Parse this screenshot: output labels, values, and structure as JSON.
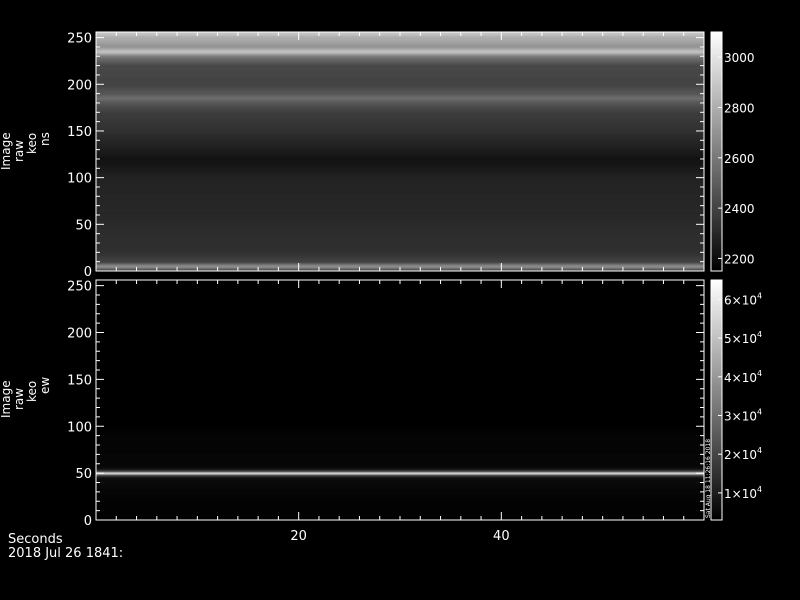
{
  "footer": {
    "xlabel": "Seconds",
    "date": "2018 Jul 26 1841:"
  },
  "colors": {
    "background": "#000000",
    "axis": "#ffffff"
  },
  "chart_data": [
    {
      "type": "heatmap",
      "ylabel_lines": [
        "Image",
        "raw",
        "keo",
        "ns"
      ],
      "ylim": [
        0,
        256
      ],
      "yticks": [
        0,
        50,
        100,
        150,
        200,
        250
      ],
      "xlim": [
        0,
        60
      ],
      "xticks": [
        20,
        40
      ],
      "xtick_labels_shown": false,
      "colorbar": {
        "range": [
          2150,
          3100
        ],
        "ticks": [
          2200,
          2400,
          2600,
          2800,
          3000
        ],
        "tick_labels": [
          "2200",
          "2400",
          "2600",
          "2800",
          "3000"
        ]
      },
      "row_profile": {
        "y": [
          0,
          5,
          10,
          20,
          40,
          60,
          80,
          100,
          115,
          120,
          130,
          150,
          170,
          180,
          185,
          190,
          200,
          220,
          225,
          230,
          235,
          240,
          250,
          256
        ],
        "value": [
          2350,
          2700,
          2400,
          2330,
          2320,
          2300,
          2290,
          2280,
          2230,
          2220,
          2260,
          2330,
          2380,
          2470,
          2560,
          2480,
          2400,
          2420,
          2500,
          2600,
          2900,
          2700,
          2800,
          2900
        ]
      }
    },
    {
      "type": "heatmap",
      "ylabel_lines": [
        "Image",
        "raw",
        "keo",
        "ew"
      ],
      "ylim": [
        0,
        256
      ],
      "yticks": [
        0,
        50,
        100,
        150,
        200,
        250
      ],
      "xlim": [
        0,
        60
      ],
      "xticks": [
        20,
        40
      ],
      "xtick_labels": [
        "20",
        "40"
      ],
      "colorbar": {
        "range": [
          3000,
          65000
        ],
        "ticks": [
          10000,
          20000,
          30000,
          40000,
          50000,
          60000
        ],
        "tick_labels": [
          {
            "mantissa": "1×10",
            "exp": "4"
          },
          {
            "mantissa": "2×10",
            "exp": "4"
          },
          {
            "mantissa": "3×10",
            "exp": "4"
          },
          {
            "mantissa": "4×10",
            "exp": "4"
          },
          {
            "mantissa": "5×10",
            "exp": "4"
          },
          {
            "mantissa": "6×10",
            "exp": "4"
          }
        ],
        "side_note": "Sat Aug 18 11:26:16 2018"
      },
      "row_profile": {
        "y": [
          0,
          20,
          30,
          45,
          48,
          50,
          52,
          55,
          60,
          80,
          95,
          100,
          150,
          256
        ],
        "value": [
          3500,
          3800,
          4500,
          6000,
          20000,
          65000,
          20000,
          6000,
          4500,
          4200,
          3800,
          3000,
          3000,
          3000
        ]
      }
    }
  ]
}
